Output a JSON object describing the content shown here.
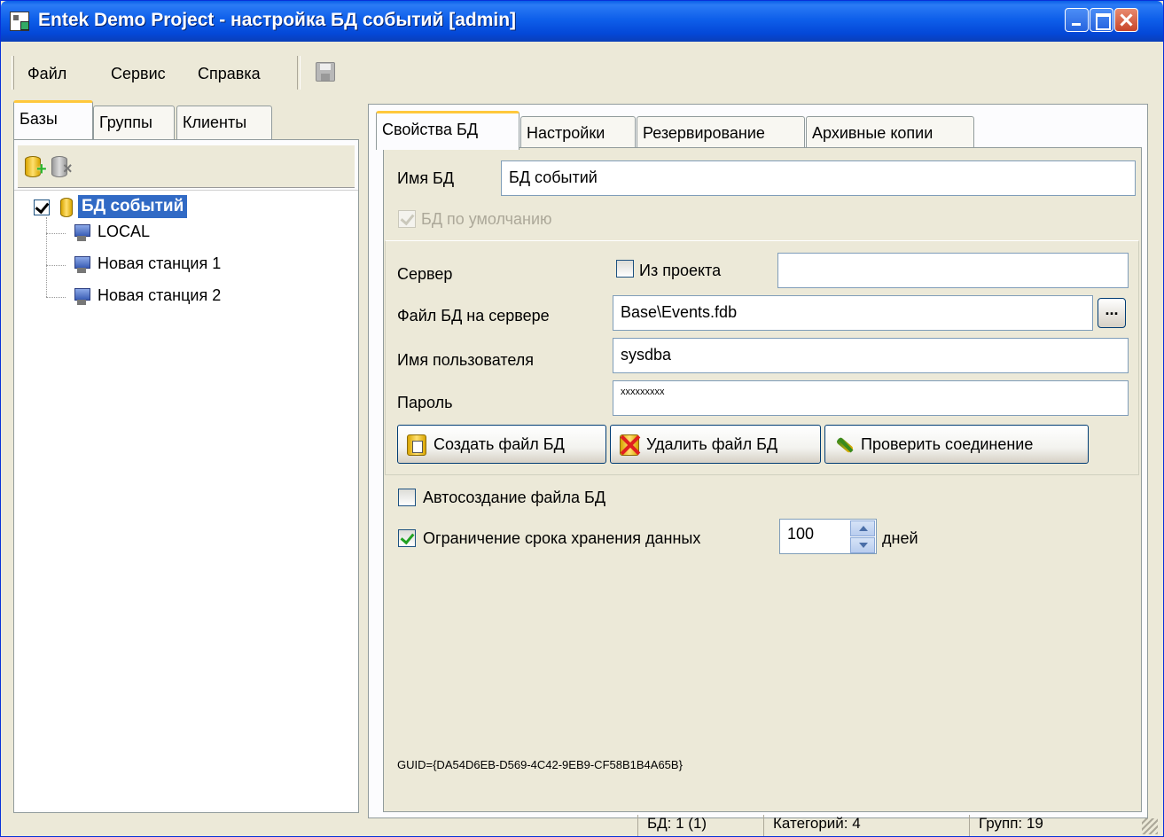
{
  "window": {
    "title": "Entek Demo Project - настройка БД событий [admin]"
  },
  "menu": {
    "file": "Файл",
    "service": "Сервис",
    "help": "Справка"
  },
  "left_tabs": [
    "Базы",
    "Группы",
    "Клиенты"
  ],
  "tree": {
    "root": "БД событий",
    "root_checked": true,
    "items": [
      "LOCAL",
      "Новая станция 1",
      "Новая станция 2"
    ]
  },
  "right_tabs": [
    "Свойства БД",
    "Настройки",
    "Резервирование",
    "Архивные копии"
  ],
  "props": {
    "db_name_label": "Имя БД",
    "db_name_value": "БД событий",
    "default_db_label": "БД по умолчанию",
    "server_label": "Сервер",
    "from_project_label": "Из проекта",
    "server_value": "",
    "file_label": "Файл БД на сервере",
    "file_value": "Base\\Events.fdb",
    "ellipsis": "...",
    "user_label": "Имя пользователя",
    "user_value": "sysdba",
    "password_label": "Пароль",
    "password_value": "xxxxxxxxx",
    "btn_create": "Создать файл БД",
    "btn_delete": "Удалить файл БД",
    "btn_check": "Проверить соединение",
    "autocreate_label": "Автосоздание файла БД",
    "limit_label": "Ограничение срока хранения данных",
    "limit_value": "100",
    "days_label": "дней",
    "guid": "GUID={DA54D6EB-D569-4C42-9EB9-CF58B1B4A65B}"
  },
  "status": {
    "db": "БД: 1 (1)",
    "categories": "Категорий: 4",
    "groups": "Групп: 19"
  }
}
